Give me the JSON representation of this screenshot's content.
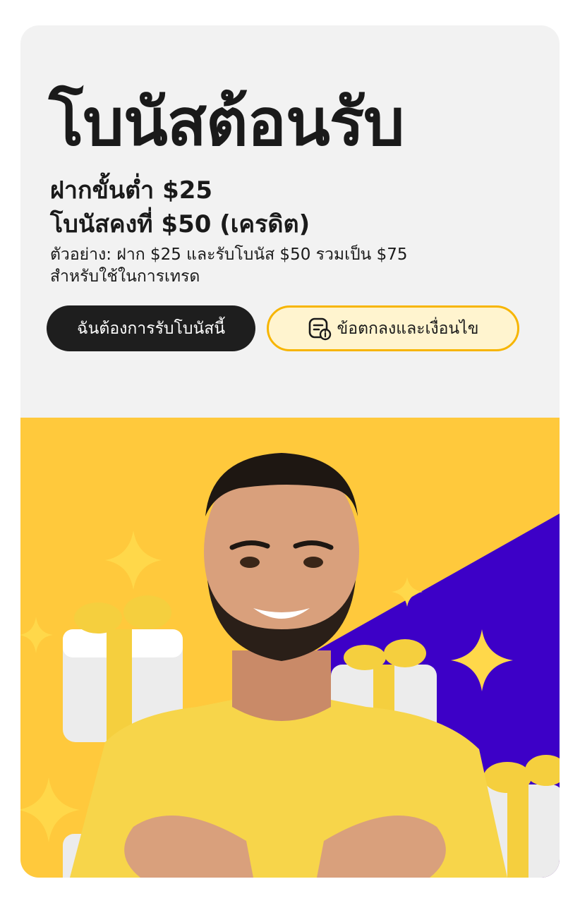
{
  "promo": {
    "title": "โบนัสต้อนรับ",
    "min_deposit": "ฝากขั้นต่ำ $25",
    "fixed_bonus": "โบนัสคงที่ $50 (เครดิต)",
    "example_line1": "ตัวอย่าง: ฝาก $25 และรับโบนัส $50 รวมเป็น $75",
    "example_line2": "สำหรับใช้ในการเทรด"
  },
  "buttons": {
    "claim_label": "ฉันต้องการรับโบนัสนี้",
    "terms_label": "ข้อตกลงและเงื่อนไข",
    "terms_icon": "document-info-icon"
  },
  "hero": {
    "image": "smiling-man-with-gifts-illustration",
    "colors": {
      "background": "#ffc93c",
      "accent": "#3d00c7",
      "shirt": "#f7d54a",
      "sparkle": "#ffd84a"
    }
  }
}
